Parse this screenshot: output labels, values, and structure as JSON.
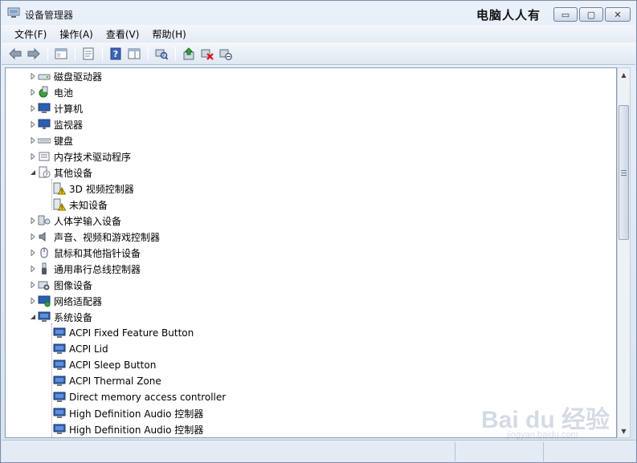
{
  "window": {
    "title": "设备管理器",
    "overlay_title": "电脑人人有",
    "controls": {
      "minimize": "▭",
      "maximize": "▢",
      "close": "✕"
    }
  },
  "menubar": {
    "items": [
      {
        "label": "文件(F)"
      },
      {
        "label": "操作(A)"
      },
      {
        "label": "查看(V)"
      },
      {
        "label": "帮助(H)"
      }
    ]
  },
  "toolbar": {
    "icons": [
      "back-icon",
      "forward-icon",
      "up-level-icon",
      "properties-icon",
      "help-icon",
      "show-hide-tree-icon",
      "scan-hardware-icon",
      "update-driver-icon",
      "uninstall-icon",
      "disable-icon"
    ]
  },
  "tree": {
    "rows": [
      {
        "label": "磁盘驱动器",
        "icon": "disk-drive-icon",
        "level": 0,
        "expander": "collapsed"
      },
      {
        "label": "电池",
        "icon": "battery-icon",
        "level": 0,
        "expander": "collapsed"
      },
      {
        "label": "计算机",
        "icon": "computer-icon",
        "level": 0,
        "expander": "collapsed"
      },
      {
        "label": "监视器",
        "icon": "monitor-icon",
        "level": 0,
        "expander": "collapsed"
      },
      {
        "label": "键盘",
        "icon": "keyboard-icon",
        "level": 0,
        "expander": "collapsed"
      },
      {
        "label": "内存技术驱动程序",
        "icon": "memory-tech-icon",
        "level": 0,
        "expander": "collapsed"
      },
      {
        "label": "其他设备",
        "icon": "unknown-device-icon",
        "level": 0,
        "expander": "expanded"
      },
      {
        "label": "3D 视频控制器",
        "icon": "warning-device-icon",
        "level": 1,
        "expander": "none"
      },
      {
        "label": "未知设备",
        "icon": "warning-device-icon",
        "level": 1,
        "expander": "none"
      },
      {
        "label": "人体学输入设备",
        "icon": "hid-icon",
        "level": 0,
        "expander": "collapsed"
      },
      {
        "label": "声音、视频和游戏控制器",
        "icon": "speaker-icon",
        "level": 0,
        "expander": "collapsed"
      },
      {
        "label": "鼠标和其他指针设备",
        "icon": "mouse-icon",
        "level": 0,
        "expander": "collapsed"
      },
      {
        "label": "通用串行总线控制器",
        "icon": "usb-icon",
        "level": 0,
        "expander": "collapsed"
      },
      {
        "label": "图像设备",
        "icon": "camera-icon",
        "level": 0,
        "expander": "collapsed"
      },
      {
        "label": "网络适配器",
        "icon": "network-adapter-icon",
        "level": 0,
        "expander": "collapsed"
      },
      {
        "label": "系统设备",
        "icon": "system-device-icon",
        "level": 0,
        "expander": "expanded"
      },
      {
        "label": "ACPI Fixed Feature Button",
        "icon": "system-device-icon",
        "level": 1,
        "expander": "none"
      },
      {
        "label": "ACPI Lid",
        "icon": "system-device-icon",
        "level": 1,
        "expander": "none"
      },
      {
        "label": "ACPI Sleep Button",
        "icon": "system-device-icon",
        "level": 1,
        "expander": "none"
      },
      {
        "label": "ACPI Thermal Zone",
        "icon": "system-device-icon",
        "level": 1,
        "expander": "none"
      },
      {
        "label": "Direct memory access controller",
        "icon": "system-device-icon",
        "level": 1,
        "expander": "none"
      },
      {
        "label": "High Definition Audio 控制器",
        "icon": "system-device-icon",
        "level": 1,
        "expander": "none"
      },
      {
        "label": "High Definition Audio 控制器",
        "icon": "system-device-icon",
        "level": 1,
        "expander": "none"
      }
    ]
  },
  "scrollbar": {
    "up_arrow": "▲",
    "down_arrow": "▼"
  },
  "watermark": {
    "brand": "Bai du 经验",
    "url": "jingyan.baidu.com"
  },
  "colors": {
    "selection_blue": "#1f5fbf",
    "warning_yellow": "#f2c200",
    "window_bg": "#dbe6f4"
  }
}
